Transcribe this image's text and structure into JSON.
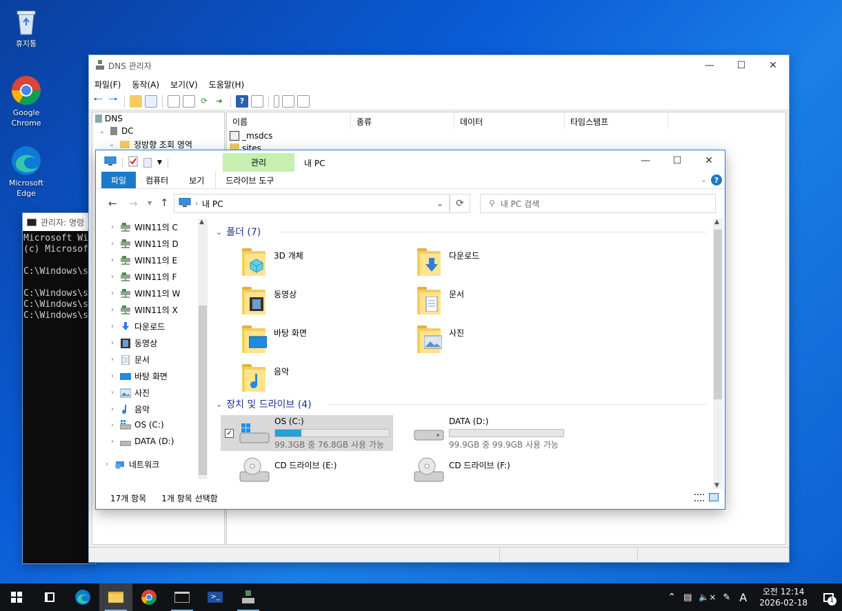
{
  "desktop": {
    "icons": [
      {
        "label": "휴지통",
        "icon": "recycle-bin-icon"
      },
      {
        "label": "Google Chrome",
        "icon": "chrome-icon"
      },
      {
        "label": "Microsoft Edge",
        "icon": "edge-icon"
      }
    ]
  },
  "dns": {
    "title": "DNS 관리자",
    "menu": [
      "파일(F)",
      "동작(A)",
      "보기(V)",
      "도움말(H)"
    ],
    "tree": {
      "root": "DNS",
      "server": "DC",
      "zone": "정방향 조회 영역"
    },
    "columns": [
      "이름",
      "종류",
      "데이터",
      "타임스탬프"
    ],
    "rows": [
      "_msdcs",
      "sites"
    ]
  },
  "cmd": {
    "title": "관리자: 명령",
    "lines": [
      "Microsoft Wi",
      "(c) Microsof",
      "",
      "C:\\Windows\\s",
      "",
      "C:\\Windows\\s",
      "C:\\Windows\\s",
      "C:\\Windows\\s"
    ]
  },
  "explorer": {
    "title": "내 PC",
    "manage_tab": "관리",
    "drive_tools_tab": "드라이브 도구",
    "tabs": [
      "파일",
      "컴퓨터",
      "보기"
    ],
    "address": "내 PC",
    "search_placeholder": "내 PC 검색",
    "nav_items": [
      {
        "label": "WIN11의 C",
        "icon": "network-drive-icon"
      },
      {
        "label": "WIN11의 D",
        "icon": "network-drive-icon"
      },
      {
        "label": "WIN11의 E",
        "icon": "network-drive-icon"
      },
      {
        "label": "WIN11의 F",
        "icon": "network-drive-icon"
      },
      {
        "label": "WIN11의 W",
        "icon": "network-drive-icon"
      },
      {
        "label": "WIN11의 X",
        "icon": "network-drive-icon"
      },
      {
        "label": "다운로드",
        "icon": "download-icon"
      },
      {
        "label": "동영상",
        "icon": "video-icon"
      },
      {
        "label": "문서",
        "icon": "document-icon"
      },
      {
        "label": "바탕 화면",
        "icon": "desktop-icon"
      },
      {
        "label": "사진",
        "icon": "picture-icon"
      },
      {
        "label": "음악",
        "icon": "music-icon"
      },
      {
        "label": "OS (C:)",
        "icon": "os-drive-icon"
      },
      {
        "label": "DATA (D:)",
        "icon": "drive-icon"
      }
    ],
    "network": "네트워크",
    "folders_header": "폴더 (7)",
    "folders": [
      {
        "label": "3D 개체",
        "icon": "3d-objects-icon"
      },
      {
        "label": "다운로드",
        "icon": "download-icon"
      },
      {
        "label": "동영상",
        "icon": "video-icon"
      },
      {
        "label": "문서",
        "icon": "document-icon"
      },
      {
        "label": "바탕 화면",
        "icon": "desktop-icon"
      },
      {
        "label": "사진",
        "icon": "picture-icon"
      },
      {
        "label": "음악",
        "icon": "music-icon"
      }
    ],
    "drives_header": "장치 및 드라이브 (4)",
    "drives": [
      {
        "label": "OS (C:)",
        "free": "99.3GB 중 76.8GB 사용 가능",
        "used_fraction": 0.23
      },
      {
        "label": "DATA (D:)",
        "free": "99.9GB 중 99.9GB 사용 가능",
        "used_fraction": 0.0
      },
      {
        "label": "CD 드라이브 (E:)"
      },
      {
        "label": "CD 드라이브 (F:)"
      }
    ],
    "status": {
      "count": "17개 항목",
      "selected": "1개 항목 선택함"
    }
  },
  "taskbar": {
    "time": "오전 12:14",
    "date": "2026-02-18",
    "ime": "A",
    "notif_count": "1"
  },
  "colors": {
    "accent": "#1979ca",
    "manage": "#c6efb1",
    "drive_fill": "#26a0da"
  }
}
